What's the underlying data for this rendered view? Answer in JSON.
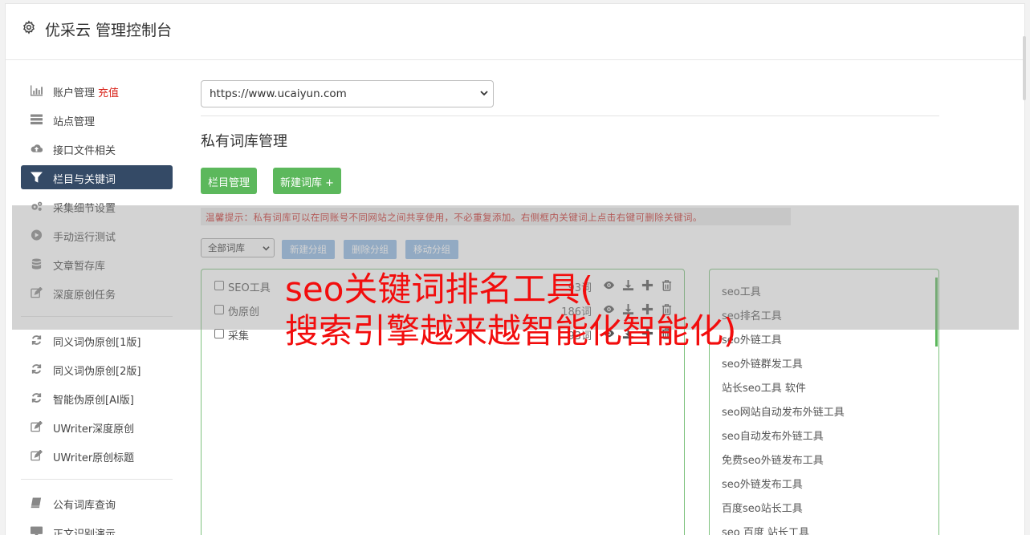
{
  "header": {
    "title": "优采云 管理控制台"
  },
  "sidebar": {
    "items": [
      {
        "label": "账户管理",
        "extra": "充值",
        "icon": "bar-chart-icon",
        "active": false
      },
      {
        "label": "站点管理",
        "icon": "server-icon",
        "active": false
      },
      {
        "label": "接口文件相关",
        "icon": "cloud-upload-icon",
        "active": false
      },
      {
        "label": "栏目与关键词",
        "icon": "filter-icon",
        "active": true
      },
      {
        "label": "采集细节设置",
        "icon": "cogs-icon",
        "active": false
      },
      {
        "label": "手动运行测试",
        "icon": "play-circle-icon",
        "active": false
      },
      {
        "label": "文章暂存库",
        "icon": "database-icon",
        "active": false
      },
      {
        "label": "深度原创任务",
        "icon": "edit-icon",
        "active": false
      },
      {
        "label": "同义词伪原创[1版]",
        "icon": "refresh-icon",
        "active": false
      },
      {
        "label": "同义词伪原创[2版]",
        "icon": "refresh-icon",
        "active": false
      },
      {
        "label": "智能伪原创[AI版]",
        "icon": "refresh-icon",
        "active": false
      },
      {
        "label": "UWriter深度原创",
        "icon": "edit-icon",
        "active": false
      },
      {
        "label": "UWriter原创标题",
        "icon": "edit-icon",
        "active": false
      },
      {
        "label": "公有词库查询",
        "icon": "book-icon",
        "active": false
      },
      {
        "label": "正文识别演示",
        "icon": "monitor-icon",
        "active": false
      }
    ]
  },
  "main": {
    "site_select": "https://www.ucaiyun.com",
    "section_title": "私有词库管理",
    "btn_column": "栏目管理",
    "btn_new_lib": "新建词库 +",
    "tip": "温馨提示：私有词库可以在同账号不同网站之间共享使用，不必重复添加。右侧框内关键词上点击右键可删除关键词。",
    "lib_select": "全部词库",
    "btn_new_group": "新建分组",
    "btn_delete_group": "删除分组",
    "btn_move_group": "移动分组",
    "groups": [
      {
        "name": "SEO工具",
        "count": "93词"
      },
      {
        "name": "伪原创",
        "count": "186词"
      },
      {
        "name": "采集",
        "count": "93词"
      }
    ],
    "keywords": [
      "seo工具",
      "seo排名工具",
      "seo外链工具",
      "seo外链群发工具",
      "站长seo工具 软件",
      "seo网站自动发布外链工具",
      "seo自动发布外链工具",
      "免费seo外链发布工具",
      "seo外链发布工具",
      "百度seo站长工具",
      "seo 百度 站长工具"
    ]
  },
  "overlay": {
    "line1": "seo关键词排名工具(",
    "line2": "搜索引擎越来越智能化智能化)"
  },
  "colors": {
    "green": "#5cb85c",
    "navy": "#344a66",
    "red": "#f20d0d",
    "blue": "#8fb8e3"
  }
}
